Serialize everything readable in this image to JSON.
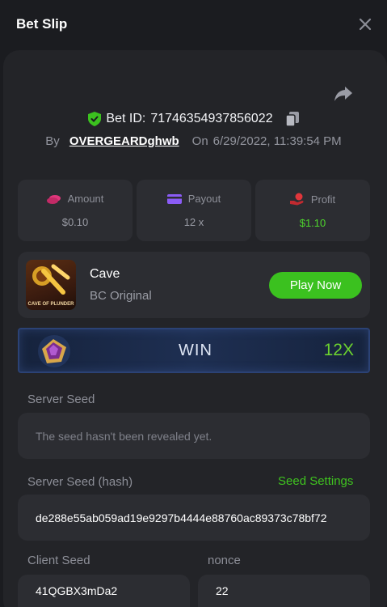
{
  "header": {
    "title": "Bet Slip"
  },
  "bet": {
    "id_label": "Bet ID:",
    "id": "71746354937856022",
    "by_label": "By",
    "username": "OVERGEARDghwb",
    "on_label": "On",
    "datetime": "6/29/2022, 11:39:54 PM"
  },
  "stats": [
    {
      "label": "Amount",
      "value": "$0.10",
      "icon": "coins-icon",
      "color": "#e0367b"
    },
    {
      "label": "Payout",
      "value": "12 x",
      "icon": "card-icon",
      "color": "#8b5cf6"
    },
    {
      "label": "Profit",
      "value": "$1.10",
      "icon": "hand-coin-icon",
      "color": "#e0363b"
    }
  ],
  "game": {
    "name": "Cave",
    "provider": "BC Original",
    "thumb_caption": "CAVE OF PLUNDER",
    "play_label": "Play Now"
  },
  "result": {
    "text": "WIN",
    "multiplier": "12X"
  },
  "seeds": {
    "server_label": "Server Seed",
    "server_value": "The seed hasn't been revealed yet.",
    "server_hash_label": "Server Seed (hash)",
    "settings_label": "Seed Settings",
    "server_hash_value": "de288e55ab059ad19e9297b4444e88760ac89373c78bf72",
    "client_label": "Client Seed",
    "client_value": "41QGBX3mDa2",
    "nonce_label": "nonce",
    "nonce_value": "22"
  },
  "colors": {
    "accent_green": "#3bc11f",
    "panel": "#232428",
    "card": "#2c2d32",
    "background": "#1b1c20"
  }
}
